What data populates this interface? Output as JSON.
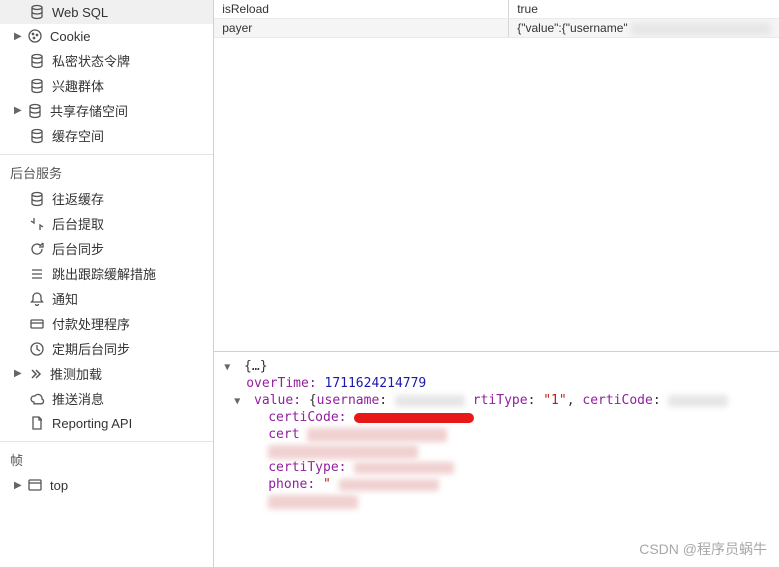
{
  "sidebar": {
    "storage_items": [
      {
        "label": "Web SQL",
        "icon": "db-icon",
        "arrow": false
      },
      {
        "label": "Cookie",
        "icon": "cookie-icon",
        "arrow": true
      },
      {
        "label": "私密状态令牌",
        "icon": "db-icon",
        "arrow": false
      },
      {
        "label": "兴趣群体",
        "icon": "db-icon",
        "arrow": false
      },
      {
        "label": "共享存储空间",
        "icon": "db-icon",
        "arrow": true
      },
      {
        "label": "缓存空间",
        "icon": "db-icon",
        "arrow": false
      }
    ],
    "services_title": "后台服务",
    "services_items": [
      {
        "label": "往返缓存",
        "icon": "db-icon"
      },
      {
        "label": "后台提取",
        "icon": "sync-icon"
      },
      {
        "label": "后台同步",
        "icon": "refresh-icon"
      },
      {
        "label": "跳出跟踪缓解措施",
        "icon": "list-icon"
      },
      {
        "label": "通知",
        "icon": "bell-icon"
      },
      {
        "label": "付款处理程序",
        "icon": "card-icon"
      },
      {
        "label": "定期后台同步",
        "icon": "clock-icon"
      },
      {
        "label": "推测加载",
        "icon": "chevrons-icon",
        "arrow": true
      },
      {
        "label": "推送消息",
        "icon": "cloud-icon"
      },
      {
        "label": "Reporting API",
        "icon": "doc-icon"
      }
    ],
    "frames_title": "帧",
    "frames_item": {
      "label": "top",
      "icon": "frame-icon",
      "arrow": true
    }
  },
  "table": {
    "rows": [
      {
        "key": "isReload",
        "value": "true"
      },
      {
        "key": "payer",
        "value": "{\"value\":{\"username\""
      }
    ]
  },
  "detail": {
    "root_label": "{…}",
    "overTime_key": "overTime",
    "overTime_val": "1711624214779",
    "value_key": "value",
    "value_open": "{",
    "username_key": "username",
    "rtiType_key": "rtiType",
    "rtiType_val": "\"1\"",
    "certiCode_key": "certiCode",
    "certiCode_key2": "certiCode",
    "cert_partial": "cert",
    "certiType_key": "certiType",
    "phone_key": "phone",
    "phone_val_partial": "\""
  },
  "watermark": "CSDN @程序员蜗牛"
}
